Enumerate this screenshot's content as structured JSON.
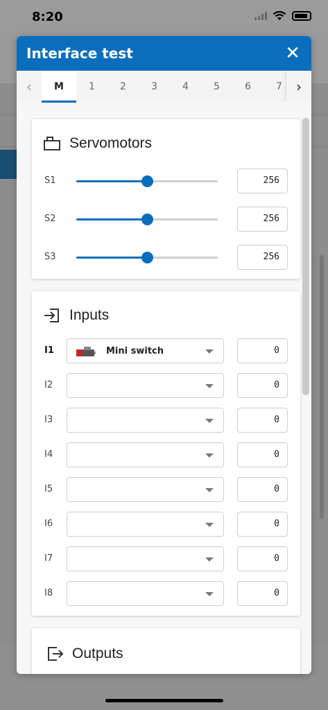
{
  "status_bar": {
    "time": "8:20"
  },
  "modal": {
    "title": "Interface test",
    "tabs": [
      "M",
      "1",
      "2",
      "3",
      "4",
      "5",
      "6",
      "7"
    ],
    "active_tab": "M"
  },
  "servomotors": {
    "title": "Servomotors",
    "rows": [
      {
        "label": "S1",
        "value": "256",
        "fraction": 0.5
      },
      {
        "label": "S2",
        "value": "256",
        "fraction": 0.5
      },
      {
        "label": "S3",
        "value": "256",
        "fraction": 0.5
      }
    ]
  },
  "inputs": {
    "title": "Inputs",
    "rows": [
      {
        "label": "I1",
        "selected": "Mini switch",
        "value": "0"
      },
      {
        "label": "I2",
        "selected": "",
        "value": "0"
      },
      {
        "label": "I3",
        "selected": "",
        "value": "0"
      },
      {
        "label": "I4",
        "selected": "",
        "value": "0"
      },
      {
        "label": "I5",
        "selected": "",
        "value": "0"
      },
      {
        "label": "I6",
        "selected": "",
        "value": "0"
      },
      {
        "label": "I7",
        "selected": "",
        "value": "0"
      },
      {
        "label": "I8",
        "selected": "",
        "value": "0"
      }
    ]
  },
  "outputs": {
    "title": "Outputs"
  },
  "colors": {
    "accent": "#0a6ebd"
  }
}
